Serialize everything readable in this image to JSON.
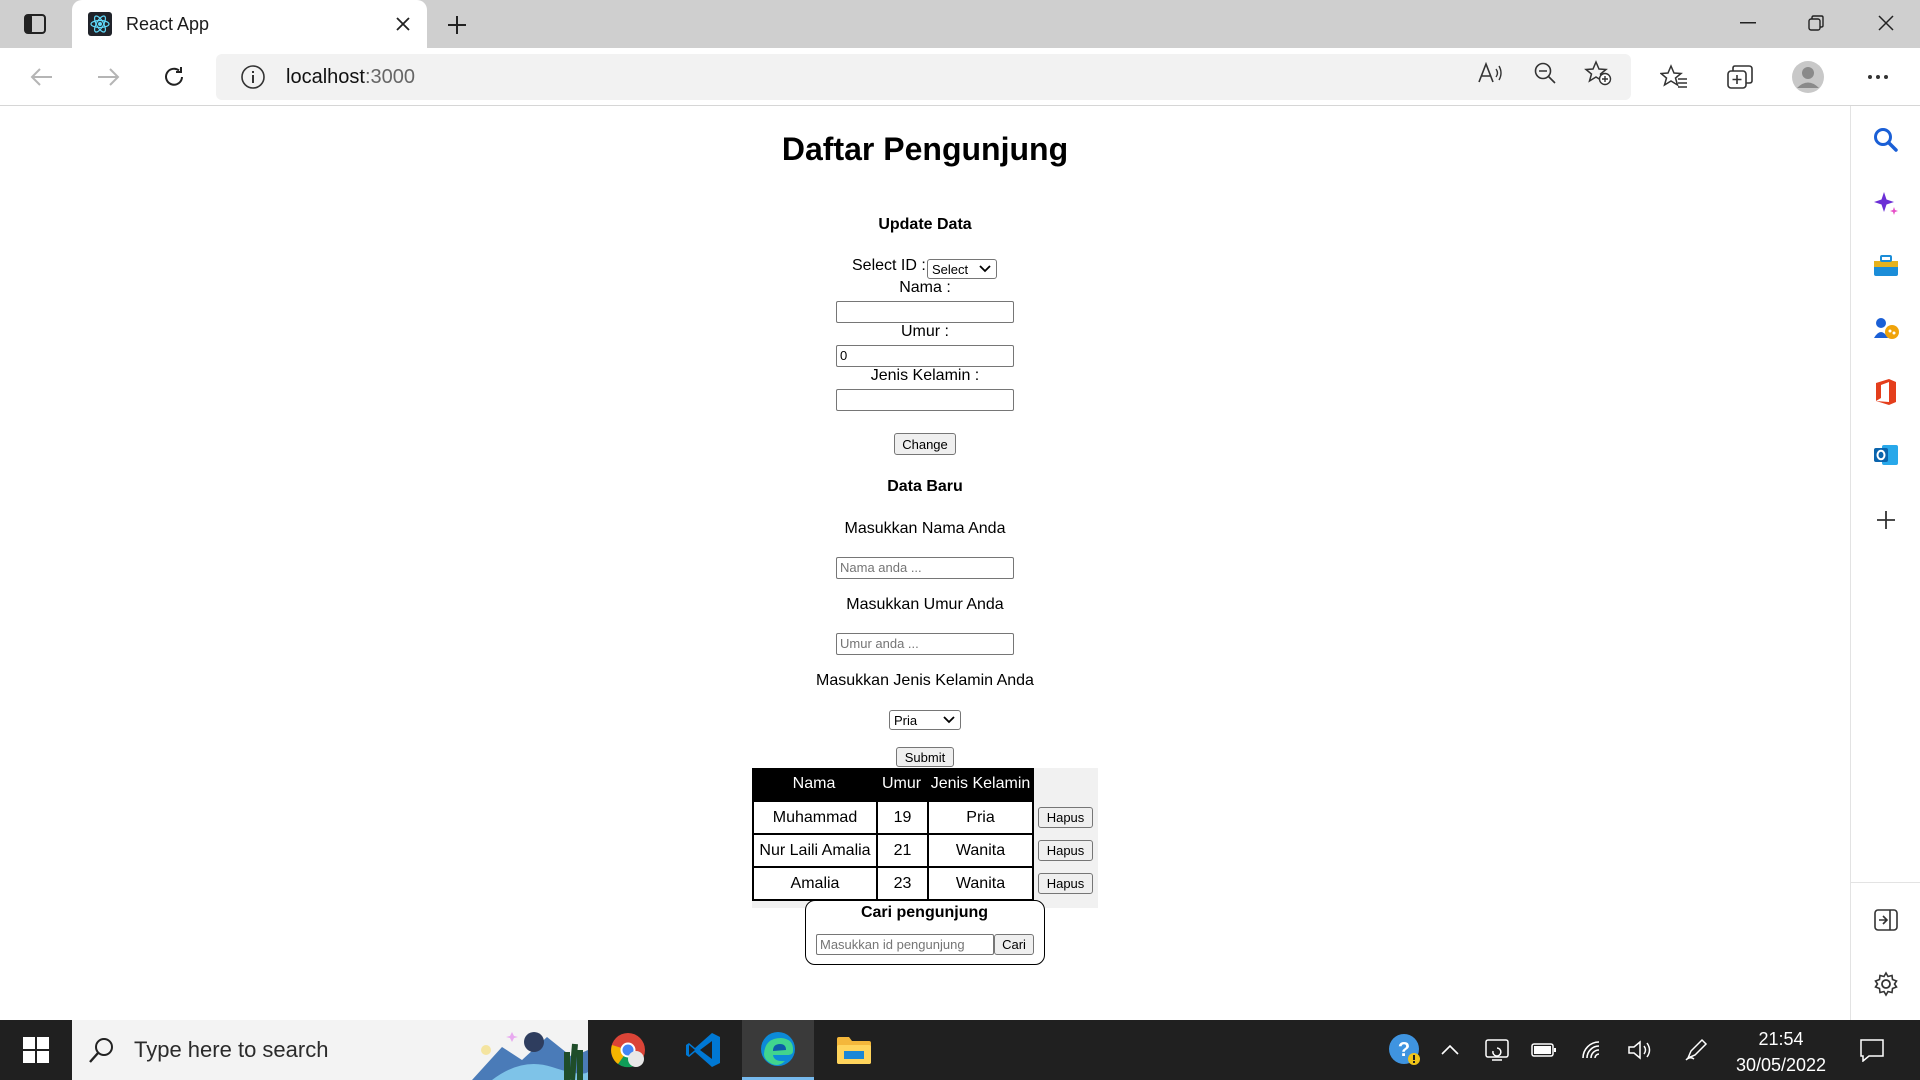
{
  "browser": {
    "tab_title": "React App",
    "url_host": "localhost",
    "url_port": ":3000"
  },
  "page": {
    "title": "Daftar Pengunjung",
    "update": {
      "heading": "Update Data",
      "select_id_label": "Select ID :",
      "select_id_value": "Select",
      "nama_label": "Nama :",
      "nama_value": "",
      "umur_label": "Umur :",
      "umur_value": "0",
      "jenis_kelamin_label": "Jenis Kelamin :",
      "jenis_kelamin_value": "",
      "change_button": "Change"
    },
    "new": {
      "heading": "Data Baru",
      "nama_label": "Masukkan Nama Anda",
      "nama_placeholder": "Nama anda ...",
      "umur_label": "Masukkan Umur Anda",
      "umur_placeholder": "Umur anda ...",
      "jk_label": "Masukkan Jenis Kelamin Anda",
      "jk_value": "Pria",
      "submit_button": "Submit"
    },
    "table": {
      "headers": [
        "Nama",
        "Umur",
        "Jenis Kelamin"
      ],
      "rows": [
        {
          "nama": "Muhammad",
          "umur": "19",
          "jk": "Pria",
          "action": "Hapus"
        },
        {
          "nama": "Nur Laili Amalia",
          "umur": "21",
          "jk": "Wanita",
          "action": "Hapus"
        },
        {
          "nama": "Amalia",
          "umur": "23",
          "jk": "Wanita",
          "action": "Hapus"
        }
      ]
    },
    "search": {
      "heading": "Cari pengunjung",
      "placeholder": "Masukkan id pengunjung",
      "button": "Cari"
    }
  },
  "taskbar": {
    "search_placeholder": "Type here to search",
    "time": "21:54",
    "date": "30/05/2022"
  }
}
